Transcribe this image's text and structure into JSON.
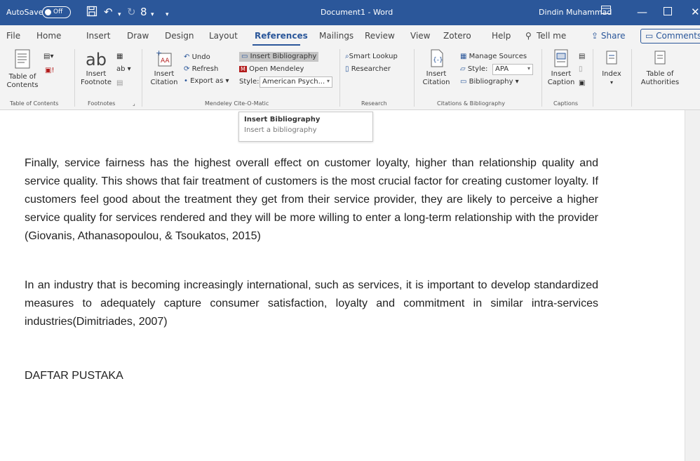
{
  "titlebar": {
    "autosave_label": "AutoSave",
    "autosave_state": "Off",
    "document_title": "Document1  -  Word",
    "user_name": "Dindin Muhammad"
  },
  "tabs": [
    {
      "label": "File"
    },
    {
      "label": "Home"
    },
    {
      "label": "Insert"
    },
    {
      "label": "Draw"
    },
    {
      "label": "Design"
    },
    {
      "label": "Layout"
    },
    {
      "label": "References",
      "active": true
    },
    {
      "label": "Mailings"
    },
    {
      "label": "Review"
    },
    {
      "label": "View"
    },
    {
      "label": "Zotero"
    },
    {
      "label": "Help"
    },
    {
      "label": "Tell me"
    }
  ],
  "share_label": "Share",
  "comments_label": "Comments",
  "ribbon": {
    "toc": {
      "label": "Table of Contents",
      "group": "Table of Contents"
    },
    "footnotes": {
      "ab": "ab",
      "label": "Insert Footnote",
      "group": "Footnotes"
    },
    "mendeley": {
      "insert_citation": "Insert Citation",
      "undo": "Undo",
      "refresh": "Refresh",
      "export_as": "Export as",
      "insert_bibliography": "Insert Bibliography",
      "open_mendeley": "Open Mendeley",
      "style_label": "Style:",
      "style_value": "American Psych...",
      "group": "Mendeley Cite-O-Matic"
    },
    "research": {
      "smart_lookup": "Smart Lookup",
      "researcher": "Researcher",
      "group": "Research"
    },
    "citations": {
      "insert_citation": "Insert Citation",
      "manage_sources": "Manage Sources",
      "style_label": "Style:",
      "style_value": "APA",
      "bibliography": "Bibliography",
      "group": "Citations & Bibliography"
    },
    "captions": {
      "insert_caption": "Insert Caption",
      "group": "Captions"
    },
    "index": {
      "label": "Index"
    },
    "authorities": {
      "label": "Table of Authorities"
    }
  },
  "tooltip": {
    "title": "Insert Bibliography",
    "description": "Insert a bibliography"
  },
  "document": {
    "paragraph1": "Finally, service fairness has the highest overall effect on customer loyalty, higher than relationship quality and service quality. This shows that fair treatment of customers is the most crucial factor for creating customer loyalty. If customers feel good about the treatment they get from their service provider, they are likely to perceive a higher service quality for services rendered and they will be more willing to enter a long-term relationship with the provider (Giovanis, Athanasopoulou, & Tsoukatos, 2015)",
    "paragraph2": "In an industry that is becoming increasingly international, such as services, it is important to develop standardized measures to adequately capture consumer satisfaction, loyalty and commitment in similar intra-services industries(Dimitriades, 2007)",
    "heading": "DAFTAR PUSTAKA"
  },
  "colors": {
    "word_blue": "#2b579a",
    "ribbon_bg": "#f3f3f3",
    "mendeley_red": "#b31b1b"
  }
}
